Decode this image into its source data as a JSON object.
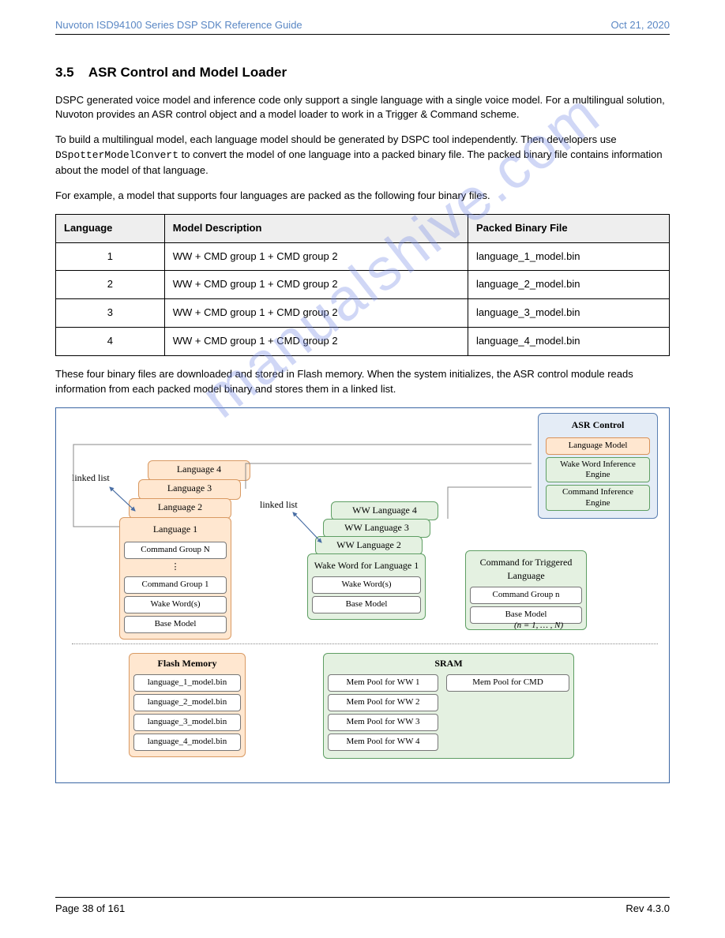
{
  "header": {
    "left": "Nuvoton ISD94100 Series DSP SDK Reference Guide",
    "right": "Oct 21, 2020"
  },
  "watermark": "manualshive.com",
  "section": {
    "number": "3.5",
    "title": "ASR Control and Model Loader",
    "para1": "DSPC generated voice model and inference code only support a single language with a single voice model. For a multilingual solution, Nuvoton provides an ASR control object and a model loader to work in a Trigger & Command scheme.",
    "para2_a": "To build a multilingual model, each language model should be generated by DSPC tool independently. Then developers use ",
    "para2_code": "DSpotterModelConvert",
    "para2_b": " to convert the model of one language into a packed binary file. The packed binary file contains information about the model of that language.",
    "para3": "For example, a model that supports four languages are packed as the following four binary files."
  },
  "table": {
    "headers": [
      "Language",
      "Model Description",
      "Packed Binary File"
    ],
    "rows": [
      [
        "1",
        "WW + CMD group 1 + CMD group 2",
        "language_1_model.bin"
      ],
      [
        "2",
        "WW + CMD group 1 + CMD group 2",
        "language_2_model.bin"
      ],
      [
        "3",
        "WW + CMD group 1 + CMD group 2",
        "language_3_model.bin"
      ],
      [
        "4",
        "WW + CMD group 1 + CMD group 2",
        "language_4_model.bin"
      ]
    ]
  },
  "post_table": "These four binary files are downloaded and stored in Flash memory. When the system initializes, the ASR control module reads information from each packed model binary and stores them in a linked list.",
  "fig": {
    "linked_list": "linked list",
    "lang_stack": [
      "Language 4",
      "Language 3",
      "Language 2",
      "Language 1"
    ],
    "lang1_items": [
      "Command Group N",
      "⋮",
      "Command Group 1",
      "Wake Word(s)",
      "Base Model"
    ],
    "ww_stack": [
      "WW Language 4",
      "WW Language 3",
      "WW Language 2",
      "Wake Word for Language 1"
    ],
    "ww_items": [
      "Wake Word(s)",
      "Base Model"
    ],
    "cmd_box_title": "Command for Triggered Language",
    "cmd_items": [
      "Command Group n",
      "Base Model"
    ],
    "cmd_note": "(n = 1, … , N)",
    "asr_title": "ASR Control",
    "asr_items": [
      "Language Model",
      "Wake Word Inference Engine",
      "Command Inference Engine"
    ],
    "flash_title": "Flash Memory",
    "flash_items": [
      "language_1_model.bin",
      "language_2_model.bin",
      "language_3_model.bin",
      "language_4_model.bin"
    ],
    "sram_title": "SRAM",
    "sram_left": [
      "Mem Pool for WW 1",
      "Mem Pool for WW 2",
      "Mem Pool for WW 3",
      "Mem Pool for WW 4"
    ],
    "sram_right": "Mem Pool for CMD"
  },
  "footer": {
    "left": "Page 38 of 161",
    "right": "Rev 4.3.0"
  }
}
